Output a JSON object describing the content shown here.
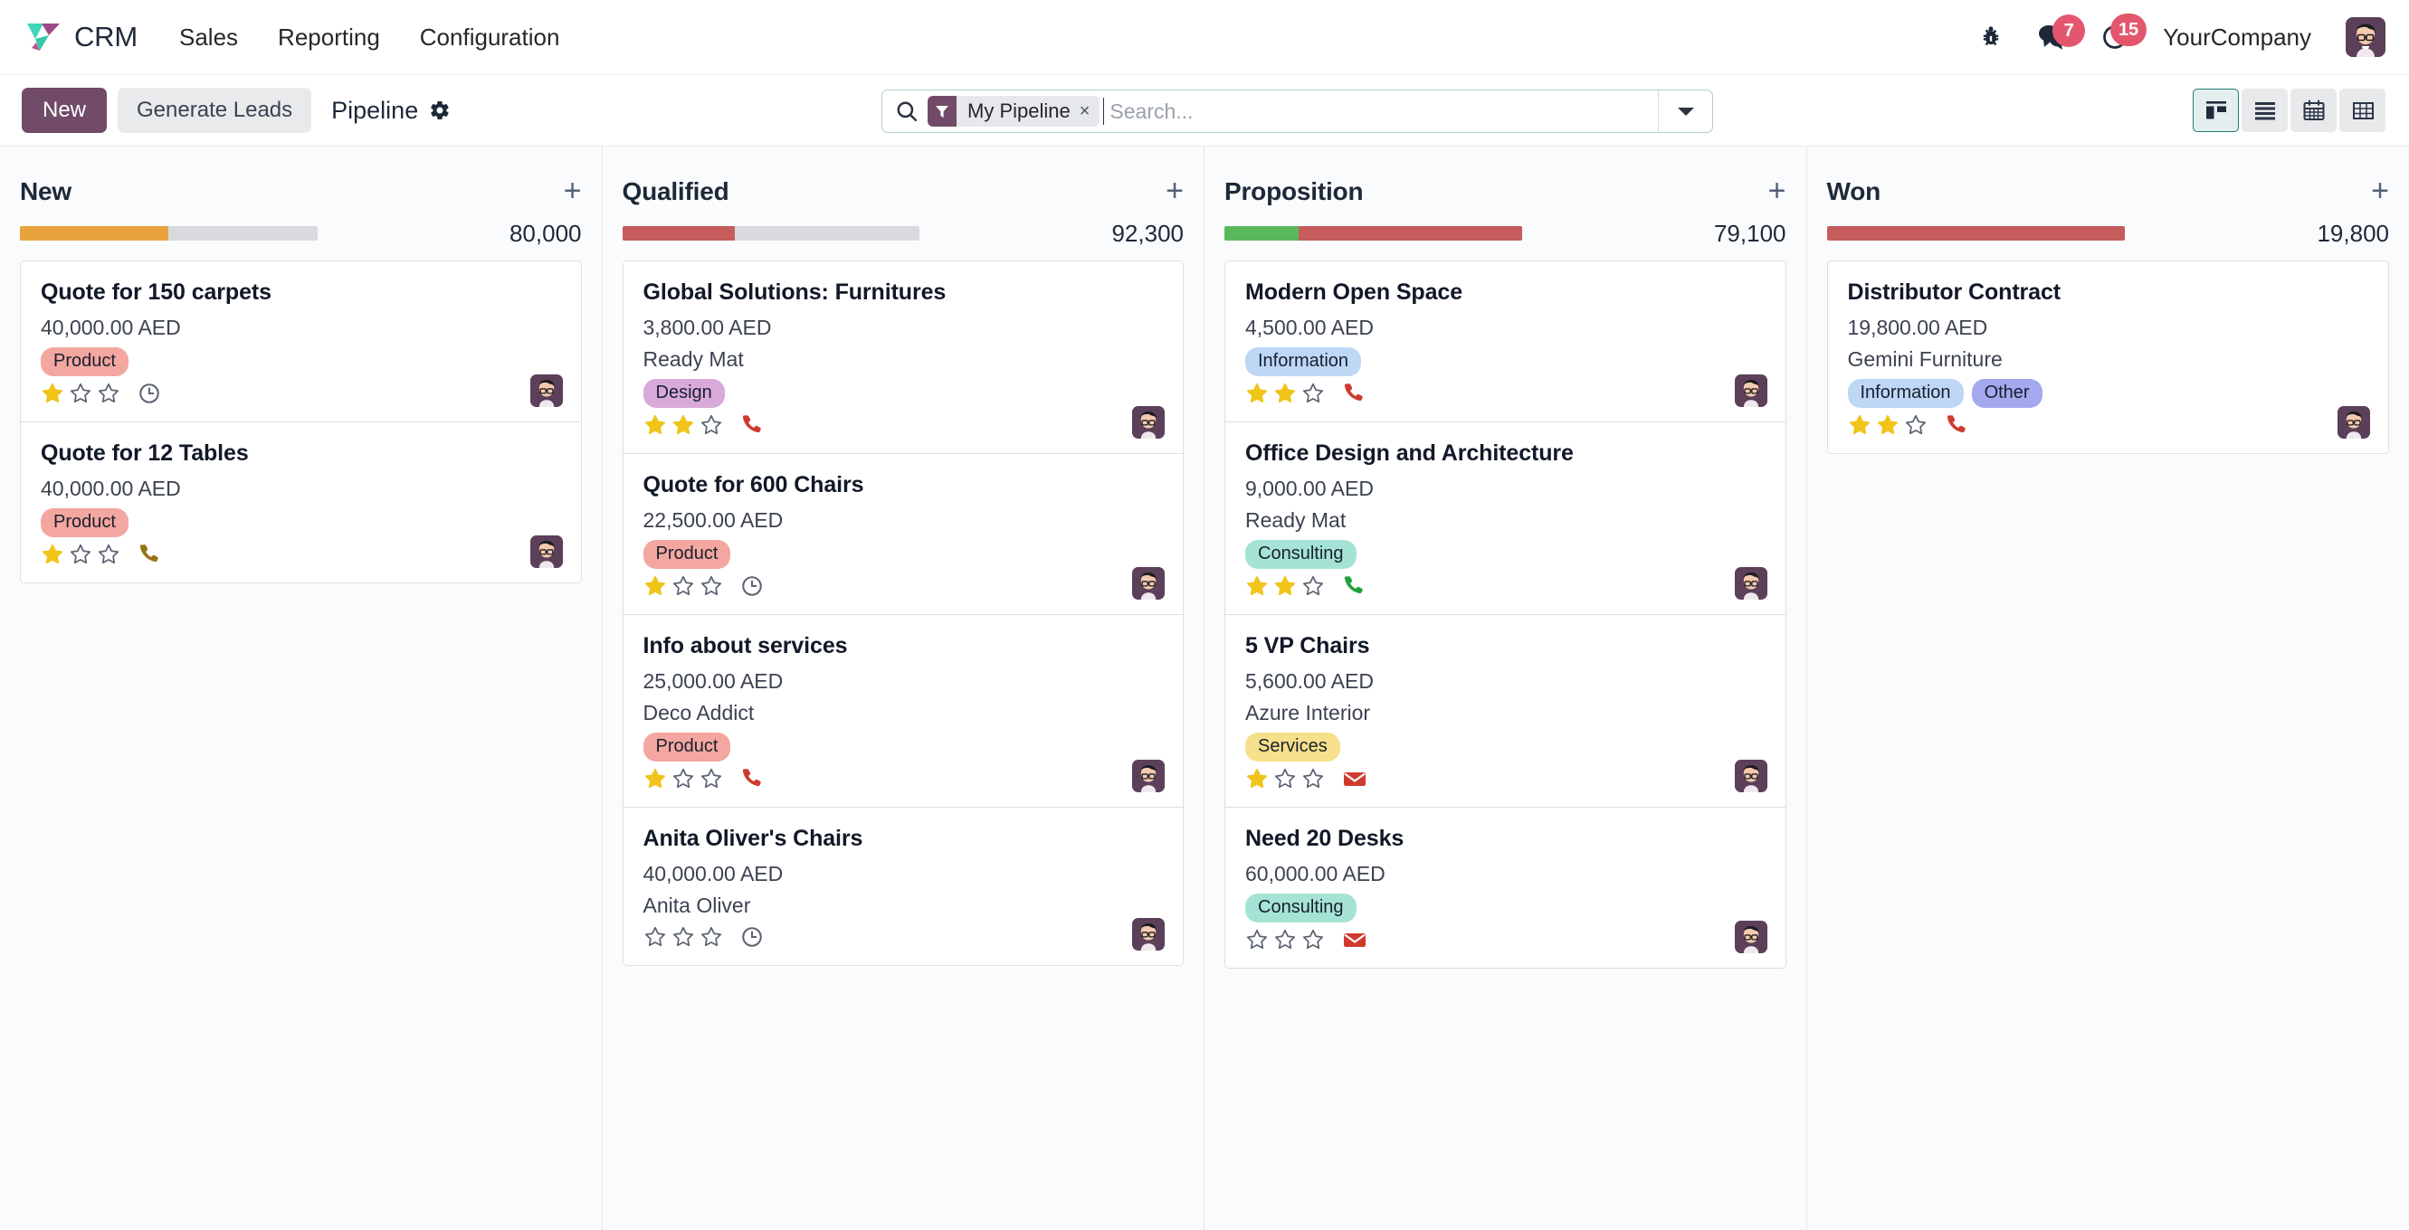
{
  "navbar": {
    "brand": "CRM",
    "menu": [
      {
        "label": "Sales"
      },
      {
        "label": "Reporting"
      },
      {
        "label": "Configuration"
      }
    ],
    "bug_icon": "bug-icon",
    "messages": {
      "icon": "chat-bubble-icon",
      "count": "7"
    },
    "activities": {
      "icon": "clock-icon",
      "count": "15"
    },
    "company": "YourCompany",
    "avatar": "user-avatar"
  },
  "control_panel": {
    "new_label": "New",
    "generate_leads_label": "Generate Leads",
    "breadcrumb": "Pipeline",
    "gear_icon": "gear-icon",
    "search": {
      "placeholder": "Search...",
      "facet_label": "My Pipeline",
      "facet_icon": "filter-funnel-icon",
      "facet_remove": "×",
      "value": ""
    },
    "views": [
      {
        "name": "kanban",
        "label": "Kanban",
        "active": true
      },
      {
        "name": "list",
        "label": "List",
        "active": false
      },
      {
        "name": "calendar",
        "label": "Calendar",
        "active": false
      },
      {
        "name": "pivot",
        "label": "Pivot",
        "active": false
      }
    ]
  },
  "colors": {
    "brand_purple": "#714b67",
    "accent_teal": "#1f7a75",
    "badge_red": "#e4566e",
    "progress_orange": "#e8a33d",
    "progress_red": "#c65c5c",
    "progress_green": "#5cb85c",
    "progress_gray": "#d8dadd",
    "tag_product": "#f4a6a0",
    "tag_design": "#d9a9d9",
    "tag_information": "#bdd7f5",
    "tag_other": "#a3a8ef",
    "tag_consulting": "#a5e3d5",
    "tag_services": "#f7e08b",
    "star_filled": "#f0c419",
    "phone_red": "#cf3a2f",
    "phone_green": "#23a03b",
    "phone_brown": "#9a7218",
    "email_red": "#cf3a2f",
    "clock_gray": "#5b6372"
  },
  "columns": [
    {
      "title": "New",
      "total": "80,000",
      "progress": [
        {
          "color": "#e8a33d",
          "width": 50
        }
      ],
      "cards": [
        {
          "title": "Quote for 150 carpets",
          "amount": "40,000.00 AED",
          "partner": "",
          "tags": [
            {
              "label": "Product",
              "color": "#f4a6a0"
            }
          ],
          "stars": 1,
          "activity": "clock-icon",
          "activity_color": "#5b6372"
        },
        {
          "title": "Quote for 12 Tables",
          "amount": "40,000.00 AED",
          "partner": "",
          "tags": [
            {
              "label": "Product",
              "color": "#f4a6a0"
            }
          ],
          "stars": 1,
          "activity": "phone-icon",
          "activity_color": "#9a7218"
        }
      ]
    },
    {
      "title": "Qualified",
      "total": "92,300",
      "progress": [
        {
          "color": "#c65c5c",
          "width": 38
        }
      ],
      "cards": [
        {
          "title": "Global Solutions: Furnitures",
          "amount": "3,800.00 AED",
          "partner": "Ready Mat",
          "tags": [
            {
              "label": "Design",
              "color": "#d9a9d9"
            }
          ],
          "stars": 2,
          "activity": "phone-icon",
          "activity_color": "#cf3a2f"
        },
        {
          "title": "Quote for 600 Chairs",
          "amount": "22,500.00 AED",
          "partner": "",
          "tags": [
            {
              "label": "Product",
              "color": "#f4a6a0"
            }
          ],
          "stars": 1,
          "activity": "clock-icon",
          "activity_color": "#5b6372"
        },
        {
          "title": "Info about services",
          "amount": "25,000.00 AED",
          "partner": "Deco Addict",
          "tags": [
            {
              "label": "Product",
              "color": "#f4a6a0"
            }
          ],
          "stars": 1,
          "activity": "phone-icon",
          "activity_color": "#cf3a2f"
        },
        {
          "title": "Anita Oliver's Chairs",
          "amount": "40,000.00 AED",
          "partner": "Anita Oliver",
          "tags": [],
          "stars": 0,
          "activity": "clock-icon",
          "activity_color": "#5b6372"
        }
      ]
    },
    {
      "title": "Proposition",
      "total": "79,100",
      "progress": [
        {
          "color": "#5cb85c",
          "width": 25
        },
        {
          "color": "#c65c5c",
          "width": 75
        }
      ],
      "cards": [
        {
          "title": "Modern Open Space",
          "amount": "4,500.00 AED",
          "partner": "",
          "tags": [
            {
              "label": "Information",
              "color": "#bdd7f5"
            }
          ],
          "stars": 2,
          "activity": "phone-icon",
          "activity_color": "#cf3a2f"
        },
        {
          "title": "Office Design and Architecture",
          "amount": "9,000.00 AED",
          "partner": "Ready Mat",
          "tags": [
            {
              "label": "Consulting",
              "color": "#a5e3d5"
            }
          ],
          "stars": 2,
          "activity": "phone-icon",
          "activity_color": "#23a03b"
        },
        {
          "title": "5 VP Chairs",
          "amount": "5,600.00 AED",
          "partner": "Azure Interior",
          "tags": [
            {
              "label": "Services",
              "color": "#f7e08b"
            }
          ],
          "stars": 1,
          "activity": "email-icon",
          "activity_color": "#cf3a2f"
        },
        {
          "title": "Need 20 Desks",
          "amount": "60,000.00 AED",
          "partner": "",
          "tags": [
            {
              "label": "Consulting",
              "color": "#a5e3d5"
            }
          ],
          "stars": 0,
          "activity": "email-icon",
          "activity_color": "#cf3a2f"
        }
      ]
    },
    {
      "title": "Won",
      "total": "19,800",
      "progress": [
        {
          "color": "#c65c5c",
          "width": 100
        }
      ],
      "cards": [
        {
          "title": "Distributor Contract",
          "amount": "19,800.00 AED",
          "partner": "Gemini Furniture",
          "tags": [
            {
              "label": "Information",
              "color": "#bdd7f5"
            },
            {
              "label": "Other",
              "color": "#a3a8ef"
            }
          ],
          "stars": 2,
          "activity": "phone-icon",
          "activity_color": "#cf3a2f"
        }
      ]
    }
  ]
}
